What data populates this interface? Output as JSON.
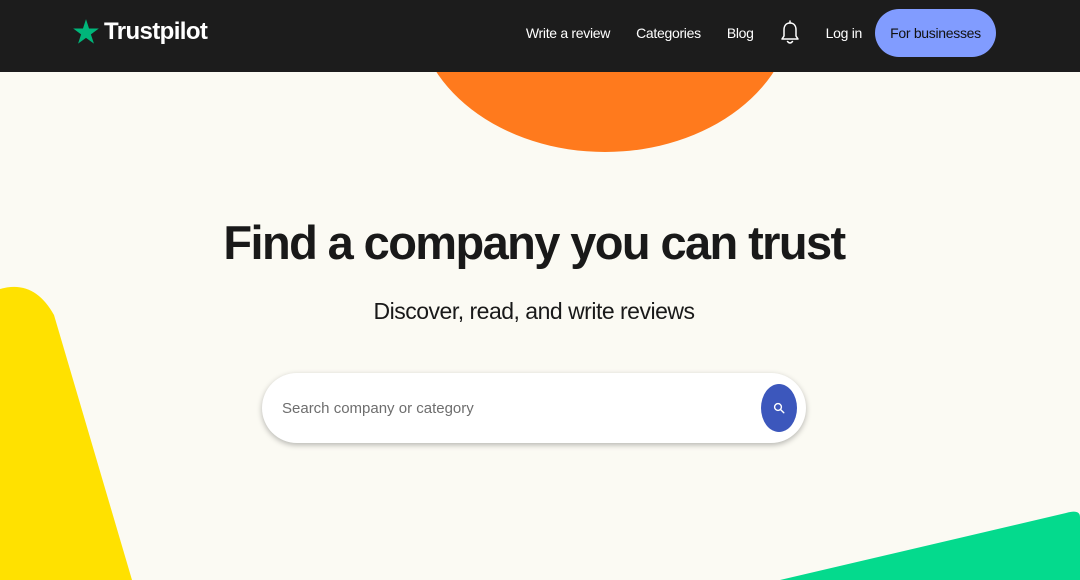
{
  "brand": {
    "name": "Trustpilot",
    "star_color": "#00b67a"
  },
  "nav": {
    "write_review": "Write a review",
    "categories": "Categories",
    "blog": "Blog",
    "login": "Log in",
    "for_businesses": "For businesses",
    "notifications_icon": "bell-icon"
  },
  "hero": {
    "title": "Find a company you can trust",
    "subtitle": "Discover, read, and write reviews"
  },
  "search": {
    "placeholder": "Search company or category",
    "value": "",
    "button_icon": "search-icon"
  },
  "colors": {
    "header_bg": "#1c1c1c",
    "page_bg": "#fbfaf3",
    "cta_bg": "#819cff",
    "search_button": "#3c57bc",
    "orange_shape": "#ff7a1d",
    "yellow_shape": "#ffe100",
    "green_shape": "#04da8d"
  }
}
